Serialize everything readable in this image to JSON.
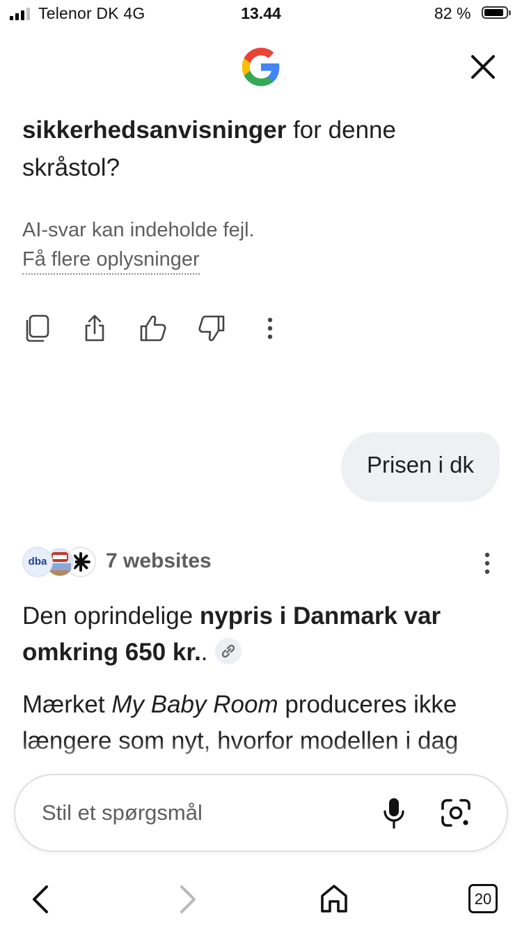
{
  "status_bar": {
    "carrier": "Telenor DK  4G",
    "time": "13.44",
    "battery": "82 %",
    "battery_level": 0.82,
    "signal_bars": 3
  },
  "header": {
    "logo_icon": "google-g-icon",
    "close_icon": "close-icon"
  },
  "question": {
    "bold": "sikkerhedsanvisninger",
    "rest": " for denne skråstol?"
  },
  "disclaimer": {
    "text": "AI-svar kan indeholde fejl.",
    "link": "Få flere oplysninger"
  },
  "actions": [
    {
      "icon": "copy-icon"
    },
    {
      "icon": "share-icon"
    },
    {
      "icon": "thumbs-up-icon"
    },
    {
      "icon": "thumbs-down-icon"
    },
    {
      "icon": "more-vert-icon"
    }
  ],
  "user_message": "Prisen i dk",
  "answer": {
    "sources": {
      "label": "7 websites",
      "icons": [
        {
          "name": "dba-icon",
          "text": "dba"
        },
        {
          "name": "source-thumbnail-icon"
        },
        {
          "name": "asterisk-logo-icon"
        }
      ]
    },
    "para1_start": "Den oprindelige ",
    "para1_bold": "nypris i Danmark var omkring 650 kr.",
    "para1_end": ".",
    "para2_start": "Mærket ",
    "para2_italic": "My Baby Room",
    "para2_end": " produceres ikke længere som nyt, hvorfor modellen i dag"
  },
  "input": {
    "placeholder": "Stil et spørgsmål",
    "mic_icon": "microphone-icon",
    "lens_icon": "google-lens-icon"
  },
  "nav": {
    "tabs_count": "20"
  },
  "colors": {
    "bubble_bg": "#eef0f4",
    "muted_text": "#5e5e5e",
    "google_blue": "#4285F4",
    "google_red": "#EA4335",
    "google_yellow": "#FBBC05",
    "google_green": "#34A853"
  }
}
